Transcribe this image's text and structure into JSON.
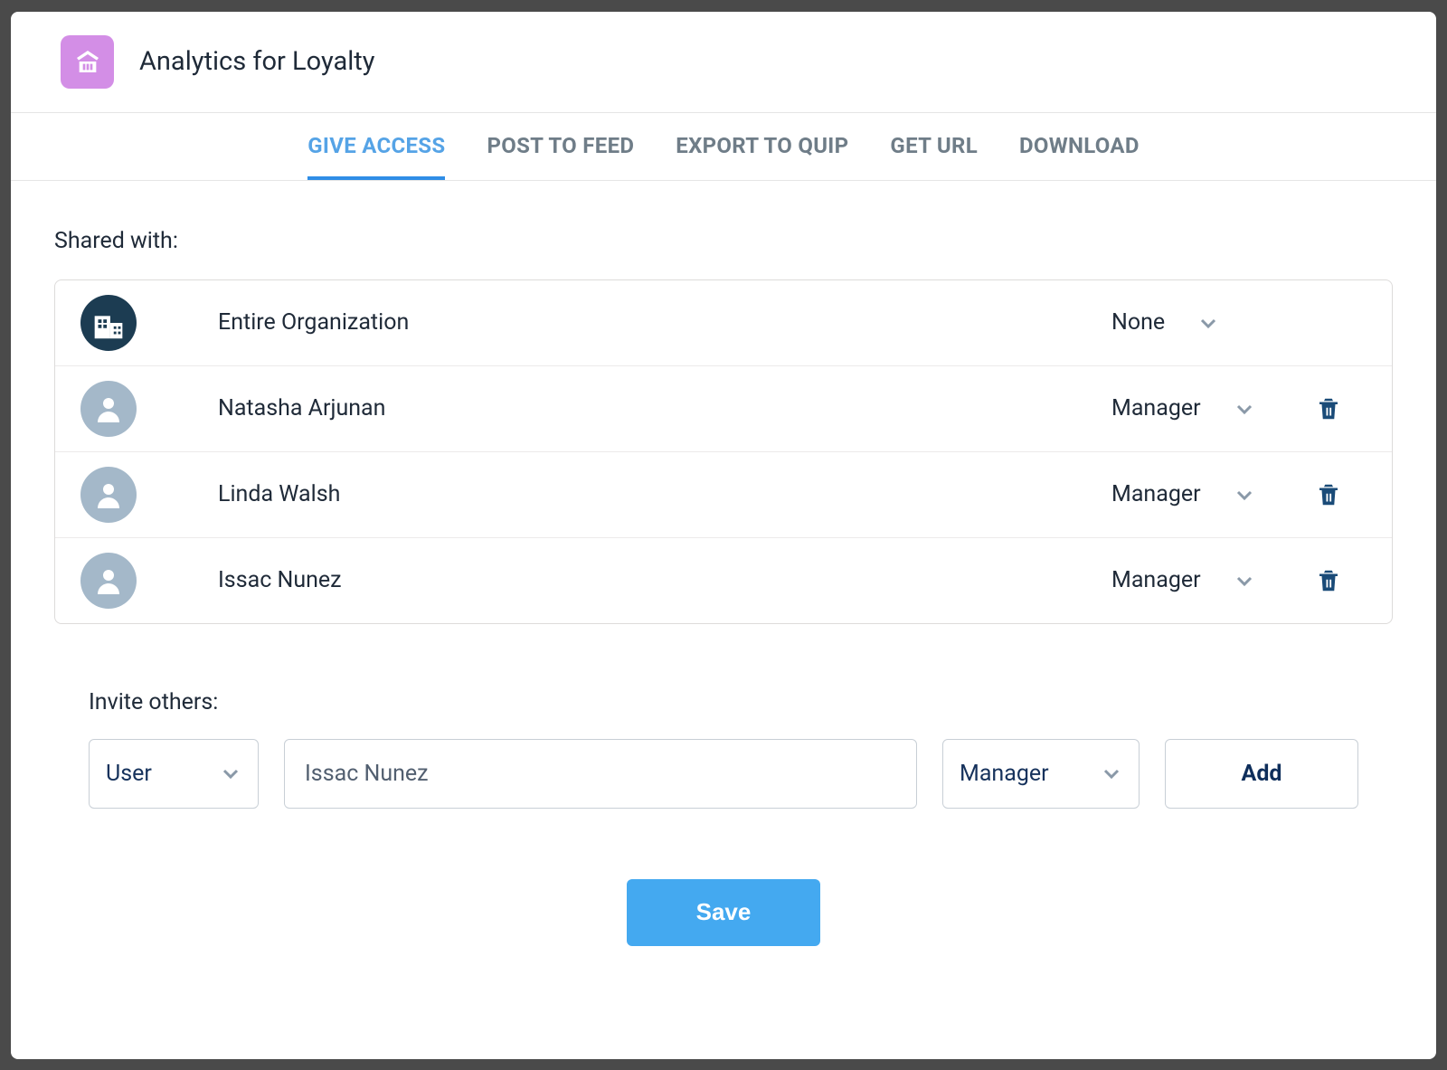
{
  "title": "Analytics for Loyalty",
  "tabs": [
    {
      "label": "GIVE ACCESS",
      "active": true
    },
    {
      "label": "POST TO FEED",
      "active": false
    },
    {
      "label": "EXPORT TO QUIP",
      "active": false
    },
    {
      "label": "GET URL",
      "active": false
    },
    {
      "label": "DOWNLOAD",
      "active": false
    }
  ],
  "shared_with_label": "Shared with:",
  "shares": [
    {
      "name": "Entire Organization",
      "permission": "None",
      "type": "org",
      "removable": false
    },
    {
      "name": "Natasha Arjunan",
      "permission": "Manager",
      "type": "user",
      "removable": true
    },
    {
      "name": "Linda Walsh",
      "permission": "Manager",
      "type": "user",
      "removable": true
    },
    {
      "name": "Issac Nunez",
      "permission": "Manager",
      "type": "user",
      "removable": true
    }
  ],
  "invite": {
    "label": "Invite others:",
    "type_value": "User",
    "name_value": "Issac Nunez",
    "role_value": "Manager",
    "add_label": "Add"
  },
  "save_label": "Save"
}
